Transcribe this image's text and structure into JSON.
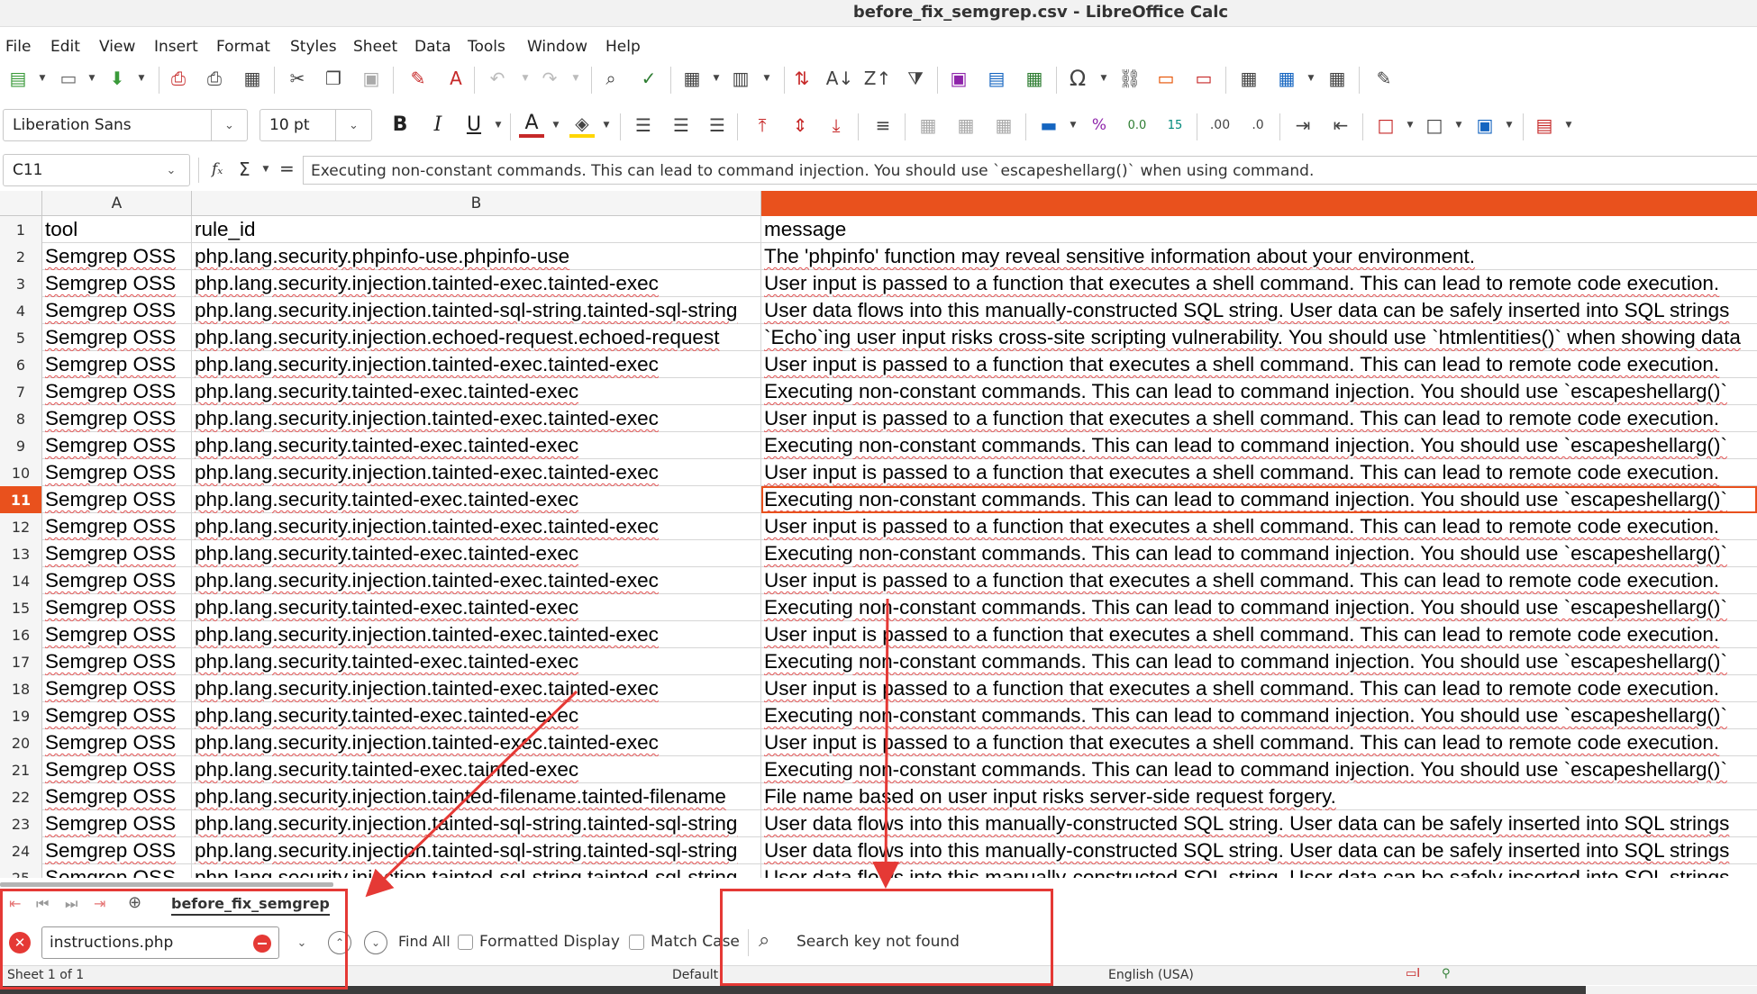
{
  "window": {
    "title": "before_fix_semgrep.csv - LibreOffice Calc"
  },
  "menu": [
    "File",
    "Edit",
    "View",
    "Insert",
    "Format",
    "Styles",
    "Sheet",
    "Data",
    "Tools",
    "Window",
    "Help"
  ],
  "font": {
    "name": "Liberation Sans",
    "size": "10 pt"
  },
  "formula": {
    "cell_ref": "C11",
    "content": "Executing non-constant commands. This can lead to command injection. You should use `escapeshellarg()` when using command.",
    "fx_symbol": "fₓ",
    "sum_symbol": "Σ",
    "eq_symbol": "="
  },
  "columns": [
    "A",
    "B",
    ""
  ],
  "selected_row": "11",
  "rows": [
    {
      "n": "1",
      "a": "tool",
      "b": "rule_id",
      "c": "message"
    },
    {
      "n": "2",
      "a": "Semgrep OSS",
      "b": "php.lang.security.phpinfo-use.phpinfo-use",
      "c": "The 'phpinfo' function may reveal sensitive information about your environment."
    },
    {
      "n": "3",
      "a": "Semgrep OSS",
      "b": "php.lang.security.injection.tainted-exec.tainted-exec",
      "c": "User input is passed to a function that executes a shell command. This can lead to remote code execution."
    },
    {
      "n": "4",
      "a": "Semgrep OSS",
      "b": "php.lang.security.injection.tainted-sql-string.tainted-sql-string",
      "c": "User data flows into this manually-constructed SQL string. User data can be safely inserted into SQL strings"
    },
    {
      "n": "5",
      "a": "Semgrep OSS",
      "b": "php.lang.security.injection.echoed-request.echoed-request",
      "c": "`Echo`ing user input risks cross-site scripting vulnerability. You should use `htmlentities()` when showing data"
    },
    {
      "n": "6",
      "a": "Semgrep OSS",
      "b": "php.lang.security.injection.tainted-exec.tainted-exec",
      "c": "User input is passed to a function that executes a shell command. This can lead to remote code execution."
    },
    {
      "n": "7",
      "a": "Semgrep OSS",
      "b": "php.lang.security.tainted-exec.tainted-exec",
      "c": "Executing non-constant commands. This can lead to command injection. You should use `escapeshellarg()`"
    },
    {
      "n": "8",
      "a": "Semgrep OSS",
      "b": "php.lang.security.injection.tainted-exec.tainted-exec",
      "c": "User input is passed to a function that executes a shell command. This can lead to remote code execution."
    },
    {
      "n": "9",
      "a": "Semgrep OSS",
      "b": "php.lang.security.tainted-exec.tainted-exec",
      "c": "Executing non-constant commands. This can lead to command injection. You should use `escapeshellarg()`"
    },
    {
      "n": "10",
      "a": "Semgrep OSS",
      "b": "php.lang.security.injection.tainted-exec.tainted-exec",
      "c": "User input is passed to a function that executes a shell command. This can lead to remote code execution."
    },
    {
      "n": "11",
      "a": "Semgrep OSS",
      "b": "php.lang.security.tainted-exec.tainted-exec",
      "c": "Executing non-constant commands. This can lead to command injection. You should use `escapeshellarg()`"
    },
    {
      "n": "12",
      "a": "Semgrep OSS",
      "b": "php.lang.security.injection.tainted-exec.tainted-exec",
      "c": "User input is passed to a function that executes a shell command. This can lead to remote code execution."
    },
    {
      "n": "13",
      "a": "Semgrep OSS",
      "b": "php.lang.security.tainted-exec.tainted-exec",
      "c": "Executing non-constant commands. This can lead to command injection. You should use `escapeshellarg()`"
    },
    {
      "n": "14",
      "a": "Semgrep OSS",
      "b": "php.lang.security.injection.tainted-exec.tainted-exec",
      "c": "User input is passed to a function that executes a shell command. This can lead to remote code execution."
    },
    {
      "n": "15",
      "a": "Semgrep OSS",
      "b": "php.lang.security.tainted-exec.tainted-exec",
      "c": "Executing non-constant commands. This can lead to command injection. You should use `escapeshellarg()`"
    },
    {
      "n": "16",
      "a": "Semgrep OSS",
      "b": "php.lang.security.injection.tainted-exec.tainted-exec",
      "c": "User input is passed to a function that executes a shell command. This can lead to remote code execution."
    },
    {
      "n": "17",
      "a": "Semgrep OSS",
      "b": "php.lang.security.tainted-exec.tainted-exec",
      "c": "Executing non-constant commands. This can lead to command injection. You should use `escapeshellarg()`"
    },
    {
      "n": "18",
      "a": "Semgrep OSS",
      "b": "php.lang.security.injection.tainted-exec.tainted-exec",
      "c": "User input is passed to a function that executes a shell command. This can lead to remote code execution."
    },
    {
      "n": "19",
      "a": "Semgrep OSS",
      "b": "php.lang.security.tainted-exec.tainted-exec",
      "c": "Executing non-constant commands. This can lead to command injection. You should use `escapeshellarg()`"
    },
    {
      "n": "20",
      "a": "Semgrep OSS",
      "b": "php.lang.security.injection.tainted-exec.tainted-exec",
      "c": "User input is passed to a function that executes a shell command. This can lead to remote code execution."
    },
    {
      "n": "21",
      "a": "Semgrep OSS",
      "b": "php.lang.security.tainted-exec.tainted-exec",
      "c": "Executing non-constant commands. This can lead to command injection. You should use `escapeshellarg()`"
    },
    {
      "n": "22",
      "a": "Semgrep OSS",
      "b": "php.lang.security.injection.tainted-filename.tainted-filename",
      "c": "File name based on user input risks server-side request forgery."
    },
    {
      "n": "23",
      "a": "Semgrep OSS",
      "b": "php.lang.security.injection.tainted-sql-string.tainted-sql-string",
      "c": "User data flows into this manually-constructed SQL string. User data can be safely inserted into SQL strings"
    },
    {
      "n": "24",
      "a": "Semgrep OSS",
      "b": "php.lang.security.injection.tainted-sql-string.tainted-sql-string",
      "c": "User data flows into this manually-constructed SQL string. User data can be safely inserted into SQL strings"
    },
    {
      "n": "25",
      "a": "Semgrep OSS",
      "b": "php.lang.security.injection.tainted-sql-string.tainted-sql-string",
      "c": "User data flows into this manually-constructed SQL string. User data can be safely inserted into SQL strings"
    }
  ],
  "sheet_tab": "before_fix_semgrep",
  "find": {
    "value": "instructions.php",
    "find_all": "Find All",
    "formatted_display": "Formatted Display",
    "match_case": "Match Case",
    "result": "Search key not found"
  },
  "status": {
    "sheet": "Sheet 1 of 1",
    "style": "Default",
    "language": "English (USA)"
  },
  "colors": {
    "accent": "#e9511d",
    "annotation": "#e53935"
  },
  "icons": [
    "new-icon",
    "open-icon",
    "save-icon",
    "export-pdf-icon",
    "print-icon",
    "print-preview-icon",
    "cut-icon",
    "copy-icon",
    "paste-icon",
    "clone-icon",
    "clear-format-icon",
    "undo-icon",
    "redo-icon",
    "find-replace-icon",
    "spellcheck-icon",
    "row-icon",
    "column-icon",
    "sort-icon",
    "sort-asc-icon",
    "sort-desc-icon",
    "autofilter-icon",
    "image-icon",
    "chart-icon",
    "pivot-icon",
    "special-char-icon",
    "hyperlink-icon",
    "comment-icon",
    "header-footer-icon",
    "define-print-icon",
    "freeze-icon",
    "split-icon",
    "draw-icon"
  ]
}
